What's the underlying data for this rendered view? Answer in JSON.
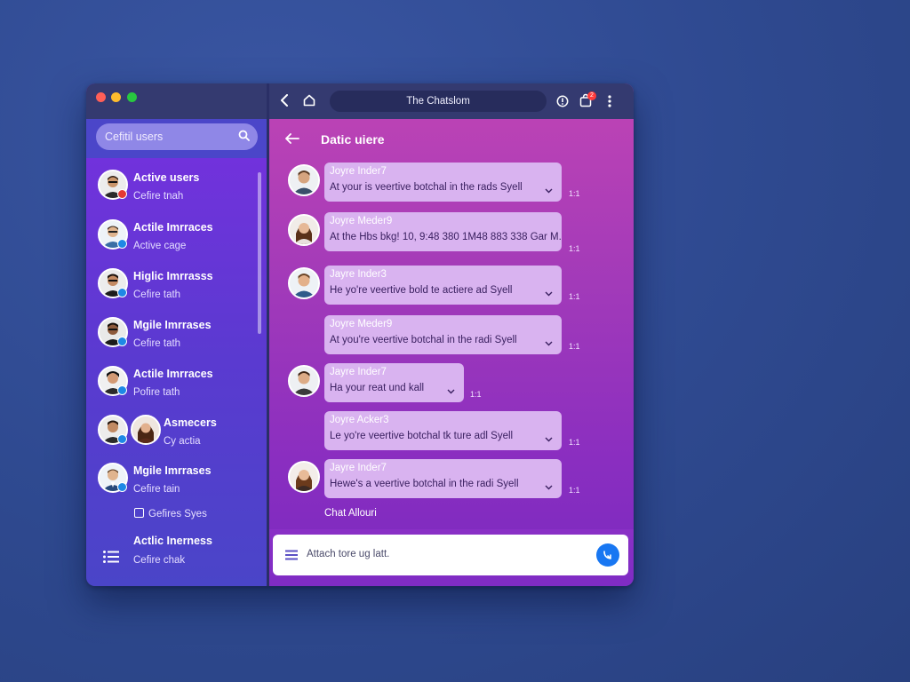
{
  "window": {
    "address_title": "The Chatslom"
  },
  "sidebar": {
    "search_placeholder": "Cefitil users",
    "users": [
      {
        "name": "Active users",
        "sub": "Cefire tnah",
        "badge": "#e53935",
        "skin": "#c9956b",
        "shirt": "#2b2b2b"
      },
      {
        "name": "Actile Imrraces",
        "sub": "Active cage",
        "badge": "#1e88e5",
        "skin": "#e0b48e",
        "shirt": "#3a6ea5"
      },
      {
        "name": "Higlic Imrrasss",
        "sub": "Cefire tath",
        "badge": "#1e88e5",
        "skin": "#c48a62",
        "shirt": "#1c1c1c"
      },
      {
        "name": "Mgile Imrrases",
        "sub": "Cefire tath",
        "badge": "#1e88e5",
        "skin": "#8d5a3c",
        "shirt": "#1c1c1c"
      },
      {
        "name": "Actile Imrraces",
        "sub": "Pofire tath",
        "badge": "#1e88e5",
        "skin": "#d39a74",
        "shirt": "#2a2a2a"
      },
      {
        "name": "Asmecers",
        "sub": "Cy actia",
        "badge": "#1e88e5",
        "skin": "#c18a63",
        "shirt": "#2a2a2a"
      },
      {
        "name": "Mgile Imrrases",
        "sub": "Cefire tain",
        "badge": "#1e88e5",
        "skin": "#e0b48e",
        "shirt": "#27497a"
      }
    ],
    "games_label": "Gefires Syes",
    "bottom_item": {
      "name": "Actlic Inerness",
      "sub": "Cefire chak"
    }
  },
  "chat": {
    "title": "Datic uiere",
    "messages": [
      {
        "name": "Joyre Inder7",
        "text": "At your is veertive botchal in the rads Syell",
        "time": "1:1",
        "avatar": true
      },
      {
        "name": "Joyre Meder9",
        "text": "At the Hbs bkg! 10, 9:48 380 1M48 883 338 Gar M.",
        "time": "1:1",
        "avatar": true
      },
      {
        "name": "Jayre Inder3",
        "text": "He yo're veertive bold te actiere ad Syell",
        "time": "1:1",
        "avatar": true
      },
      {
        "name": "Joyre Meder9",
        "text": "At you're veertive botchal in the radi Syell",
        "time": "1:1",
        "avatar": false
      },
      {
        "name": "Jayre Inder7",
        "text": "Ha your reat und kall",
        "time": "1:1",
        "avatar": true
      },
      {
        "name": "Joyre Acker3",
        "text": "Le yo're veertive botchal tk ture adl Syell",
        "time": "1:1",
        "avatar": false
      },
      {
        "name": "Jayre Inder7",
        "text": "Hewe's a veertive botchal in the radi Syell",
        "time": "1:1",
        "avatar": true
      }
    ],
    "allow_label": "Chat Allouri",
    "composer_placeholder": "Attach tore ug latt.",
    "bag_count": "2"
  }
}
